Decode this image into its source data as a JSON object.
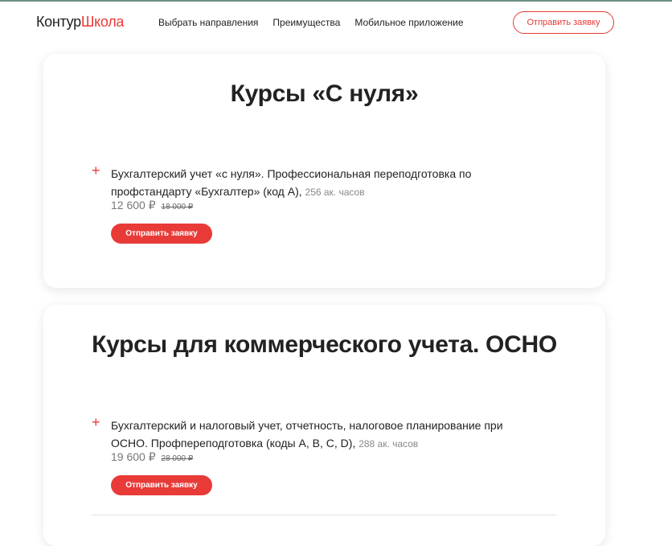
{
  "header": {
    "logo_part1": "Контур",
    "logo_part2": "Школа",
    "nav": [
      {
        "label": "Выбрать направления"
      },
      {
        "label": "Преимущества"
      },
      {
        "label": "Мобильное приложение"
      }
    ],
    "cta_label": "Отправить заявку"
  },
  "sections": [
    {
      "title": "Курсы «С нуля»",
      "course": {
        "title": "Бухгалтерский учет «с нуля». Профессиональная переподготовка по профстандарту «Бухгалтер» (код A),",
        "hours": "256 ак. часов",
        "price": "12 600 ₽",
        "old_price": "18 000 ₽",
        "button_label": "Отправить заявку"
      }
    },
    {
      "title": "Курсы для коммерческого учета. ОСНО",
      "course": {
        "title": "Бухгалтерский и налоговый учет, отчетность, налоговое планирование при ОСНО. Профпереподготовка (коды A, B, C, D),",
        "hours": "288 ак. часов",
        "price": "19 600 ₽",
        "old_price": "28 000 ₽",
        "button_label": "Отправить заявку"
      }
    }
  ],
  "colors": {
    "accent": "#e83b38",
    "text": "#222222",
    "muted": "#888888"
  },
  "icons": {
    "expand": "plus-icon"
  }
}
